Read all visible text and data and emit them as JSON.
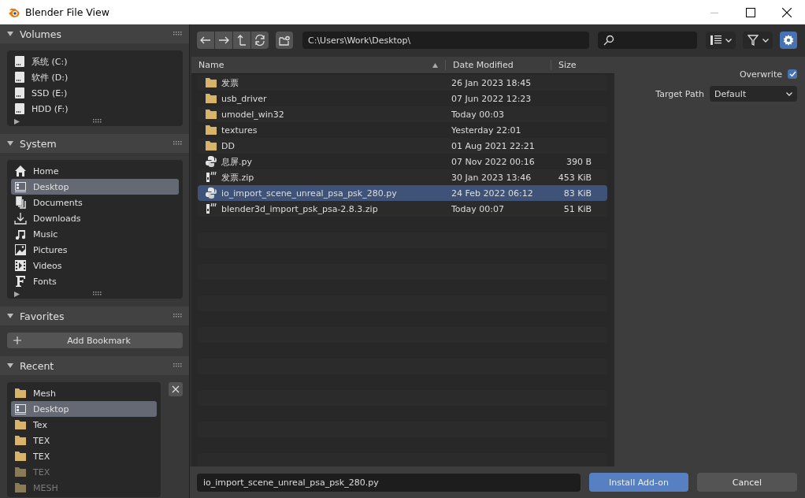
{
  "window": {
    "title": "Blender File View"
  },
  "sidebar": {
    "panels": [
      {
        "kind": "list",
        "title": "Volumes",
        "expanded": true,
        "items": [
          {
            "label": "系统 (C:)",
            "kind": "drive",
            "selected": false,
            "disabled": false
          },
          {
            "label": "软件 (D:)",
            "kind": "drive",
            "selected": false,
            "disabled": false
          },
          {
            "label": "SSD (E:)",
            "kind": "drive",
            "selected": false,
            "disabled": false
          },
          {
            "label": "HDD (F:)",
            "kind": "drive",
            "selected": false,
            "disabled": false
          }
        ]
      },
      {
        "kind": "list",
        "title": "System",
        "expanded": true,
        "items": [
          {
            "label": "Home",
            "kind": "home",
            "selected": false,
            "disabled": false
          },
          {
            "label": "Desktop",
            "kind": "desktop",
            "selected": true,
            "disabled": false
          },
          {
            "label": "Documents",
            "kind": "documents",
            "selected": false,
            "disabled": false
          },
          {
            "label": "Downloads",
            "kind": "downloads",
            "selected": false,
            "disabled": false
          },
          {
            "label": "Music",
            "kind": "music",
            "selected": false,
            "disabled": false
          },
          {
            "label": "Pictures",
            "kind": "pictures",
            "selected": false,
            "disabled": false
          },
          {
            "label": "Videos",
            "kind": "videos",
            "selected": false,
            "disabled": false
          },
          {
            "label": "Fonts",
            "kind": "fonts",
            "selected": false,
            "disabled": false
          }
        ]
      },
      {
        "kind": "button",
        "title": "Favorites",
        "expanded": true,
        "button": "Add Bookmark"
      },
      {
        "kind": "recent",
        "title": "Recent",
        "expanded": true,
        "items": [
          {
            "label": "Mesh",
            "kind": "folder",
            "selected": false,
            "disabled": false
          },
          {
            "label": "Desktop",
            "kind": "desktop",
            "selected": true,
            "disabled": false
          },
          {
            "label": "Tex",
            "kind": "folder",
            "selected": false,
            "disabled": false
          },
          {
            "label": "TEX",
            "kind": "folder",
            "selected": false,
            "disabled": false
          },
          {
            "label": "TEX",
            "kind": "folder",
            "selected": false,
            "disabled": false
          },
          {
            "label": "TEX",
            "kind": "folder",
            "selected": false,
            "disabled": true
          },
          {
            "label": "MESH",
            "kind": "folder",
            "selected": false,
            "disabled": true
          }
        ]
      }
    ]
  },
  "toolbar": {
    "path": "C:\\Users\\Work\\Desktop\\",
    "settings_on": true
  },
  "file_list": {
    "columns": [
      {
        "label": "Name",
        "sorted": true
      },
      {
        "label": "Date Modified",
        "sorted": false
      },
      {
        "label": "Size",
        "sorted": false
      }
    ],
    "rows": [
      {
        "name": "发票",
        "kind": "folder",
        "date": "26 Jan 2023 18:45",
        "size": "",
        "selected": false
      },
      {
        "name": "usb_driver",
        "kind": "folder",
        "date": "07 Jun 2022 12:23",
        "size": "",
        "selected": false
      },
      {
        "name": "umodel_win32",
        "kind": "folder",
        "date": "Today 00:03",
        "size": "",
        "selected": false
      },
      {
        "name": "textures",
        "kind": "folder",
        "date": "Yesterday 22:01",
        "size": "",
        "selected": false
      },
      {
        "name": "DD",
        "kind": "folder",
        "date": "01 Aug 2021 22:21",
        "size": "",
        "selected": false
      },
      {
        "name": "息屏.py",
        "kind": "python",
        "date": "07 Nov 2022 00:16",
        "size": "390 B",
        "selected": false
      },
      {
        "name": "发票.zip",
        "kind": "zip",
        "date": "30 Jan 2023 13:46",
        "size": "453 KiB",
        "selected": false
      },
      {
        "name": "io_import_scene_unreal_psa_psk_280.py",
        "kind": "python",
        "date": "24 Feb 2022 06:12",
        "size": "83 KiB",
        "selected": true
      },
      {
        "name": "blender3d_import_psk_psa-2.8.3.zip",
        "kind": "zip",
        "date": "Today 00:07",
        "size": "51 KiB",
        "selected": false
      }
    ]
  },
  "options": {
    "overwrite_label": "Overwrite",
    "overwrite": true,
    "target_path_label": "Target Path",
    "target_path": "Default"
  },
  "footer": {
    "filename": "io_import_scene_unreal_psa_psk_280.py",
    "confirm": "Install Add-on",
    "cancel": "Cancel"
  }
}
